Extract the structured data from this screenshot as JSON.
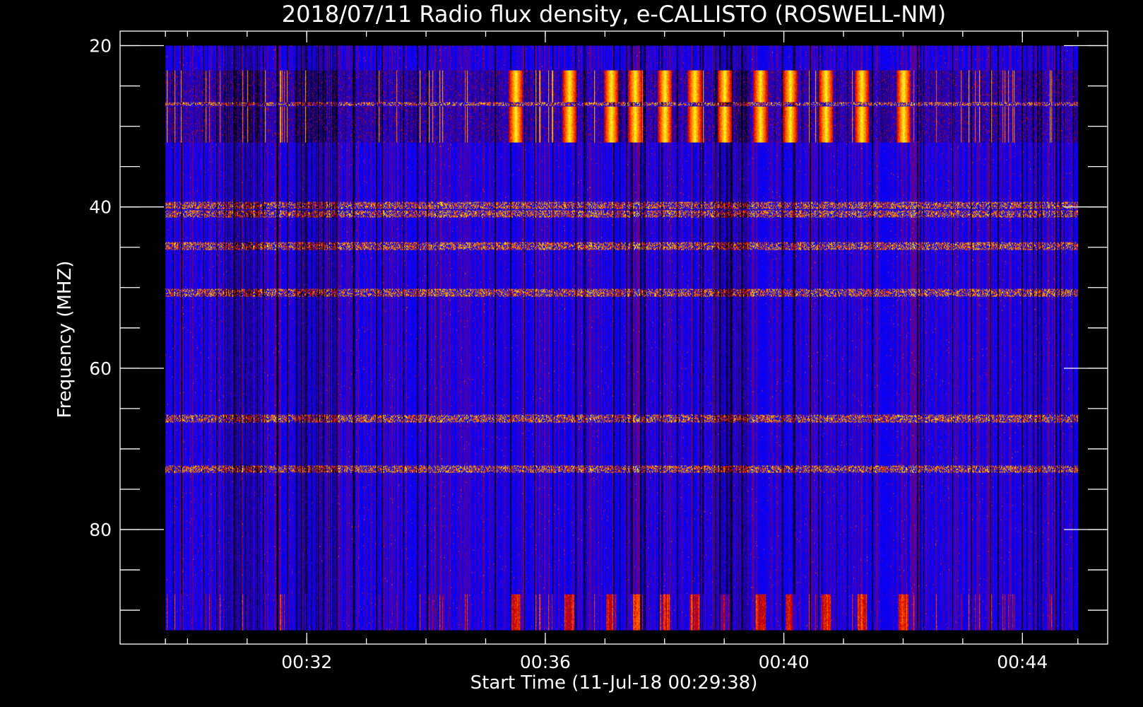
{
  "chart_data": {
    "type": "heatmap",
    "title": "2018/07/11  Radio flux density, e-CALLISTO (ROSWELL-NM)",
    "xlabel": "Start Time (11-Jul-18 00:29:38)",
    "ylabel": "Frequency (MHZ)",
    "x_start_minutes": 29.63,
    "x_end_minutes": 44.93,
    "x_axis_range_minutes": [
      28.87,
      45.43
    ],
    "x_major_ticks_minutes": [
      32,
      36,
      40,
      44
    ],
    "x_tick_labels": [
      "00:32",
      "00:36",
      "00:40",
      "00:44"
    ],
    "x_minor_tick_step_minutes": 1,
    "y_data_range_mhz": [
      20,
      92.5
    ],
    "y_axis_range_mhz": [
      18.2,
      94.2
    ],
    "y_major_ticks_mhz": [
      20,
      40,
      60,
      80
    ],
    "y_tick_labels": [
      "20",
      "40",
      "60",
      "80"
    ],
    "y_minor_tick_step_mhz": 5,
    "y_reversed": true,
    "colormap": [
      "#000000",
      "#2a00c8",
      "#0000ff",
      "#6a0088",
      "#c80000",
      "#ff4d00",
      "#ffb400",
      "#ffff3c"
    ],
    "strong_emission_bands_mhz": [
      [
        23,
        27
      ],
      [
        27.5,
        32
      ]
    ],
    "narrowband_lines_mhz": [
      27,
      39.8,
      40.8,
      44.8,
      50.6,
      66.2,
      72.5
    ],
    "bright_burst_columns_minutes": [
      35.5,
      36.4,
      37.1,
      37.5,
      38.0,
      38.5,
      39.0,
      39.6,
      40.1,
      40.7,
      41.3,
      42.0
    ],
    "weak_region_minutes": [
      [
        30.6,
        31.3
      ],
      [
        31.8,
        32.5
      ],
      [
        38.8,
        39.4
      ]
    ],
    "grid": false,
    "legend": "none"
  }
}
